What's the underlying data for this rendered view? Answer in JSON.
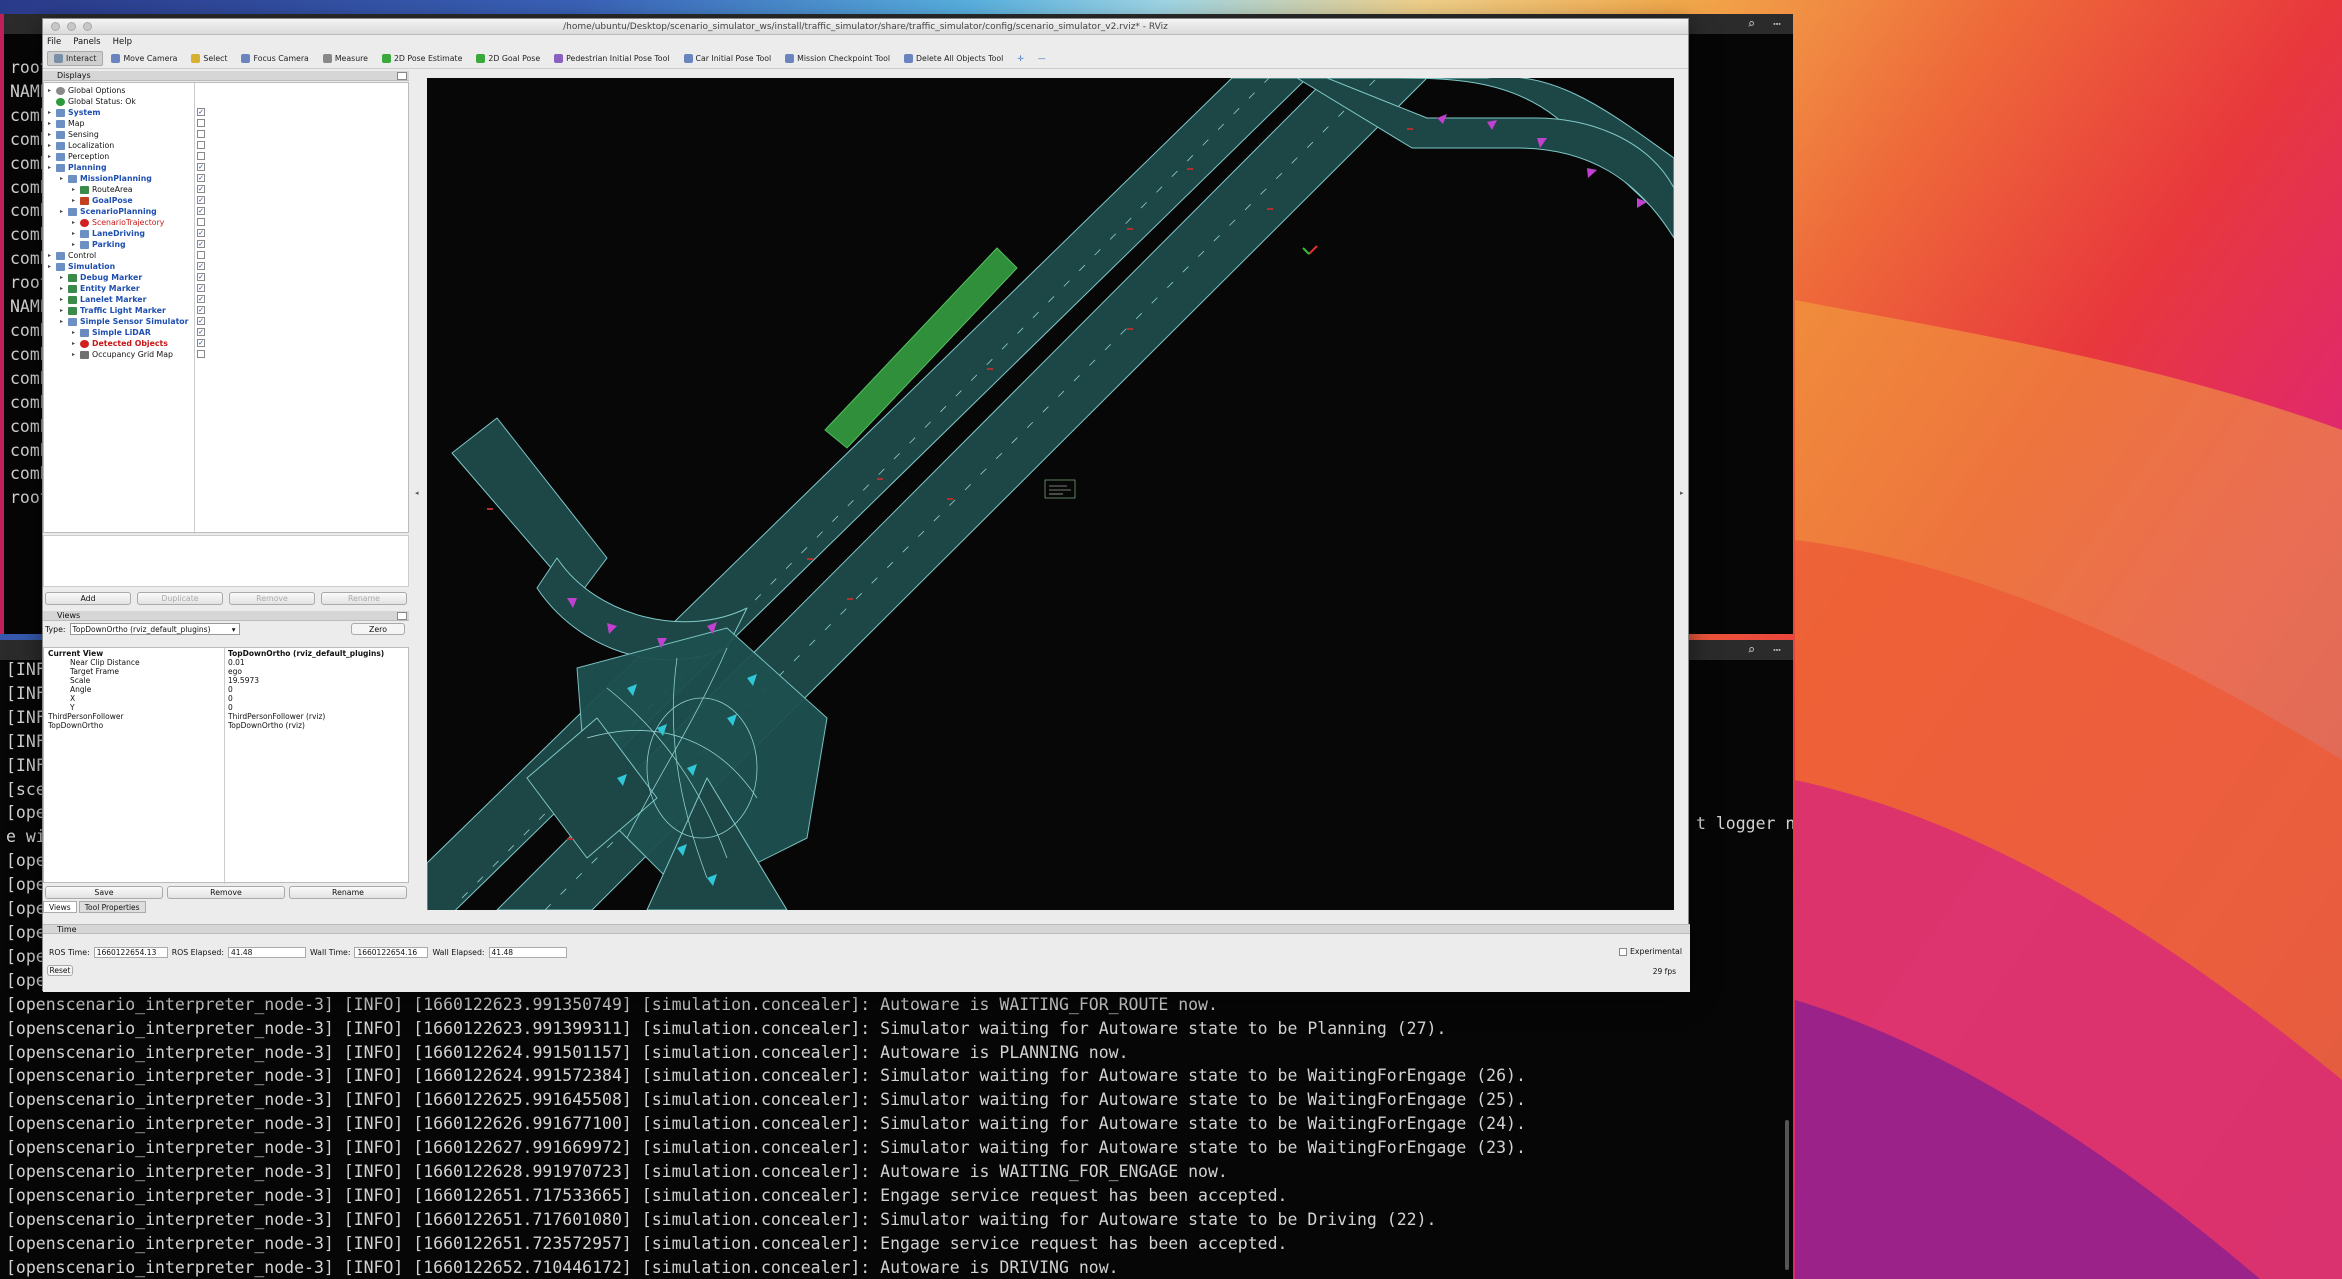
{
  "terminal_top": {
    "lines": [
      "root",
      "NAME",
      "comh",
      "comh",
      "comh",
      "comh",
      "comh",
      "comh",
      "comh",
      "root",
      "NAME",
      "comh",
      "comh",
      "comh",
      "comh",
      "comh",
      "comh",
      "comh",
      "root"
    ],
    "icons": [
      "search-icon",
      "more-icon"
    ]
  },
  "terminal_bottom": {
    "lines": [
      "[INF",
      "[INF",
      "[INF",
      "[INF",
      "[INF",
      "[sce",
      "[ope",
      "e wi",
      "[ope",
      "[ope",
      "[ope",
      "[ope",
      "[ope",
      "[ope",
      "[openscenario_interpreter_node-3] [INFO] [1660122623.991350749] [simulation.concealer]: Autoware is WAITING_FOR_ROUTE now.",
      "[openscenario_interpreter_node-3] [INFO] [1660122623.991399311] [simulation.concealer]: Simulator waiting for Autoware state to be Planning (27).",
      "[openscenario_interpreter_node-3] [INFO] [1660122624.991501157] [simulation.concealer]: Autoware is PLANNING now.",
      "[openscenario_interpreter_node-3] [INFO] [1660122624.991572384] [simulation.concealer]: Simulator waiting for Autoware state to be WaitingForEngage (26).",
      "[openscenario_interpreter_node-3] [INFO] [1660122625.991645508] [simulation.concealer]: Simulator waiting for Autoware state to be WaitingForEngage (25).",
      "[openscenario_interpreter_node-3] [INFO] [1660122626.991677100] [simulation.concealer]: Simulator waiting for Autoware state to be WaitingForEngage (24).",
      "[openscenario_interpreter_node-3] [INFO] [1660122627.991669972] [simulation.concealer]: Simulator waiting for Autoware state to be WaitingForEngage (23).",
      "[openscenario_interpreter_node-3] [INFO] [1660122628.991970723] [simulation.concealer]: Autoware is WAITING_FOR_ENGAGE now.",
      "[openscenario_interpreter_node-3] [INFO] [1660122651.717533665] [simulation.concealer]: Engage service request has been accepted.",
      "[openscenario_interpreter_node-3] [INFO] [1660122651.717601080] [simulation.concealer]: Simulator waiting for Autoware state to be Driving (22).",
      "[openscenario_interpreter_node-3] [INFO] [1660122651.723572957] [simulation.concealer]: Engage service request has been accepted.",
      "[openscenario_interpreter_node-3] [INFO] [1660122652.710446172] [simulation.concealer]: Autoware is DRIVING now."
    ],
    "right_fragment": [
      "t logger nam"
    ]
  },
  "rviz": {
    "title": "/home/ubuntu/Desktop/scenario_simulator_ws/install/traffic_simulator/share/traffic_simulator/config/scenario_simulator_v2.rviz* - RViz",
    "menu": [
      "File",
      "Panels",
      "Help"
    ],
    "toolbar": [
      "Interact",
      "Move Camera",
      "Select",
      "Focus Camera",
      "Measure",
      "2D Pose Estimate",
      "2D Goal Pose",
      "Pedestrian Initial Pose Tool",
      "Car Initial Pose Tool",
      "Mission Checkpoint Tool",
      "Delete All Objects Tool"
    ],
    "toolbar_colors": [
      "#7a8fa8",
      "#6a84c0",
      "#d8b030",
      "#6a84c0",
      "#888888",
      "#3aa83a",
      "#3aa83a",
      "#8a60c0",
      "#6a84c0",
      "#6a84c0",
      "#6a84c0"
    ],
    "displays_title": "Displays",
    "tree": [
      {
        "label": "Global Options",
        "indent": 0,
        "style": "normal",
        "icon": "gear",
        "check": ""
      },
      {
        "label": "Global Status: Ok",
        "indent": 0,
        "style": "normal",
        "icon": "check",
        "check": ""
      },
      {
        "label": "System",
        "indent": 0,
        "style": "blue",
        "icon": "folder",
        "check": "✓"
      },
      {
        "label": "Map",
        "indent": 0,
        "style": "normal",
        "icon": "folder",
        "check": ""
      },
      {
        "label": "Sensing",
        "indent": 0,
        "style": "normal",
        "icon": "folder",
        "check": ""
      },
      {
        "label": "Localization",
        "indent": 0,
        "style": "normal",
        "icon": "folder",
        "check": ""
      },
      {
        "label": "Perception",
        "indent": 0,
        "style": "normal",
        "icon": "folder",
        "check": ""
      },
      {
        "label": "Planning",
        "indent": 0,
        "style": "blue",
        "icon": "folder",
        "check": "✓"
      },
      {
        "label": "MissionPlanning",
        "indent": 1,
        "style": "blue",
        "icon": "folder",
        "check": "✓"
      },
      {
        "label": "RouteArea",
        "indent": 2,
        "style": "normal",
        "icon": "marker",
        "check": "✓"
      },
      {
        "label": "GoalPose",
        "indent": 2,
        "style": "blue",
        "icon": "pose",
        "check": "✓"
      },
      {
        "label": "ScenarioPlanning",
        "indent": 1,
        "style": "blue",
        "icon": "folder",
        "check": "✓"
      },
      {
        "label": "ScenarioTrajectory",
        "indent": 2,
        "style": "redlight",
        "icon": "error",
        "check": ""
      },
      {
        "label": "LaneDriving",
        "indent": 2,
        "style": "blue",
        "icon": "folder",
        "check": "✓"
      },
      {
        "label": "Parking",
        "indent": 2,
        "style": "blue",
        "icon": "folder",
        "check": "✓"
      },
      {
        "label": "Control",
        "indent": 0,
        "style": "normal",
        "icon": "folder",
        "check": ""
      },
      {
        "label": "Simulation",
        "indent": 0,
        "style": "blue",
        "icon": "folder",
        "check": "✓"
      },
      {
        "label": "Debug Marker",
        "indent": 1,
        "style": "blue",
        "icon": "marker",
        "check": "✓"
      },
      {
        "label": "Entity Marker",
        "indent": 1,
        "style": "blue",
        "icon": "marker",
        "check": "✓"
      },
      {
        "label": "Lanelet Marker",
        "indent": 1,
        "style": "blue",
        "icon": "marker",
        "check": "✓"
      },
      {
        "label": "Traffic Light Marker",
        "indent": 1,
        "style": "blue",
        "icon": "marker",
        "check": "✓"
      },
      {
        "label": "Simple Sensor Simulator",
        "indent": 1,
        "style": "blue",
        "icon": "folder",
        "check": "✓"
      },
      {
        "label": "Simple LiDAR",
        "indent": 2,
        "style": "blue",
        "icon": "cloud",
        "check": "✓"
      },
      {
        "label": "Detected Objects",
        "indent": 2,
        "style": "red",
        "icon": "error",
        "check": "✓"
      },
      {
        "label": "Occupancy Grid Map",
        "indent": 2,
        "style": "normal",
        "icon": "grid",
        "check": ""
      }
    ],
    "display_buttons": [
      "Add",
      "Duplicate",
      "Remove",
      "Rename"
    ],
    "views_title": "Views",
    "views_type_label": "Type:",
    "views_type_value": "TopDownOrtho (rviz_default_plugins)",
    "zero": "Zero",
    "views_rows": [
      {
        "k": "Current View",
        "v": "TopDownOrtho (rviz_default_plugins)",
        "bold": true,
        "indent": 0
      },
      {
        "k": "Near Clip Distance",
        "v": "0.01",
        "bold": false,
        "indent": 1
      },
      {
        "k": "Target Frame",
        "v": "ego",
        "bold": false,
        "indent": 1
      },
      {
        "k": "Scale",
        "v": "19.5973",
        "bold": false,
        "indent": 1
      },
      {
        "k": "Angle",
        "v": "0",
        "bold": false,
        "indent": 1
      },
      {
        "k": "X",
        "v": "0",
        "bold": false,
        "indent": 1
      },
      {
        "k": "Y",
        "v": "0",
        "bold": false,
        "indent": 1
      },
      {
        "k": "ThirdPersonFollower",
        "v": "ThirdPersonFollower (rviz)",
        "bold": false,
        "indent": 0
      },
      {
        "k": "TopDownOrtho",
        "v": "TopDownOrtho (rviz)",
        "bold": false,
        "indent": 0
      }
    ],
    "views_buttons": [
      "Save",
      "Remove",
      "Rename"
    ],
    "tabs": [
      "Views",
      "Tool Properties"
    ],
    "time": {
      "title": "Time",
      "ros_time_label": "ROS Time:",
      "ros_time": "1660122654.13",
      "ros_elapsed_label": "ROS Elapsed:",
      "ros_elapsed": "41.48",
      "wall_time_label": "Wall Time:",
      "wall_time": "1660122654.16",
      "wall_elapsed_label": "Wall Elapsed:",
      "wall_elapsed": "41.48",
      "experimental": "Experimental",
      "reset": "Reset",
      "fps": "29 fps"
    }
  },
  "colors": {
    "lane": "#1f4a4a",
    "lane_edge": "#8ad0d0",
    "route": "#2f8f3a",
    "arrow_magenta": "#c040d0",
    "arrow_cyan": "#30c8d8"
  }
}
